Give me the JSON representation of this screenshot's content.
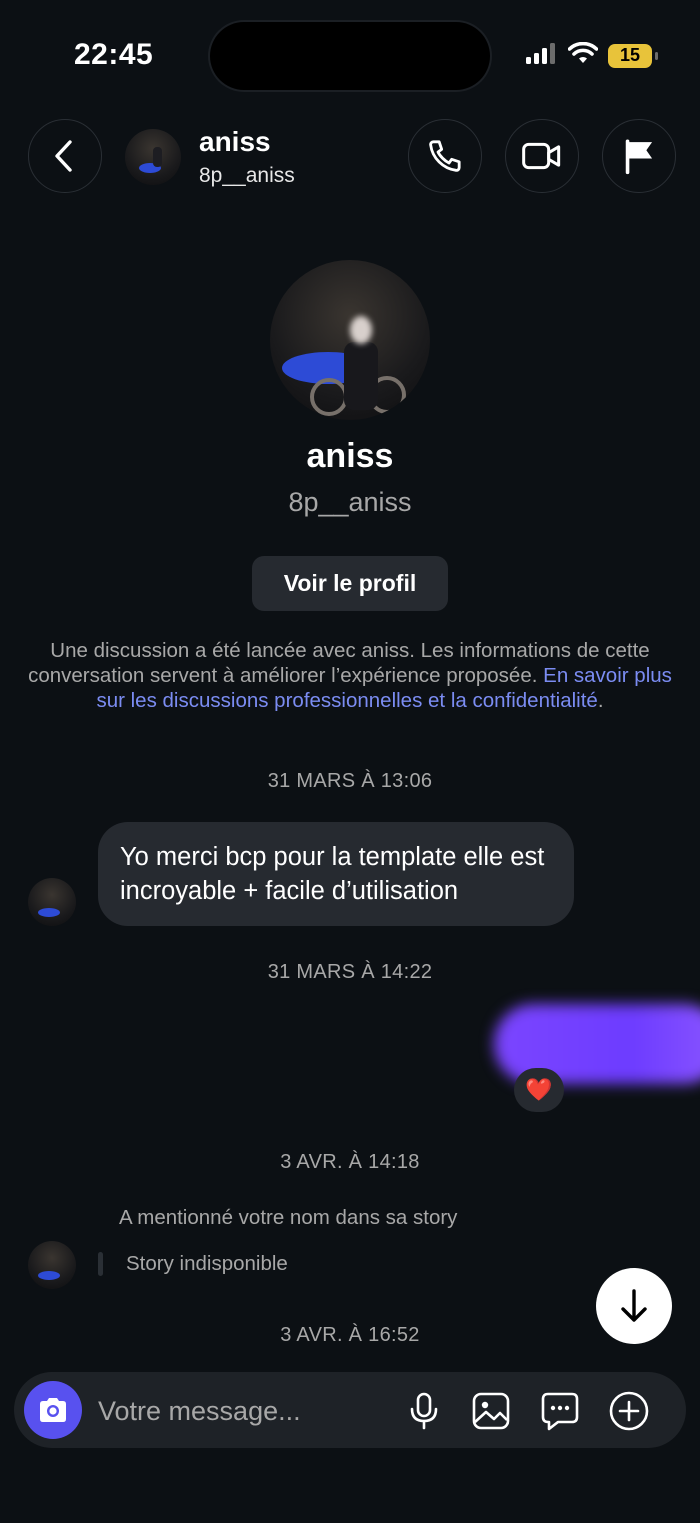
{
  "status_bar": {
    "time": "22:45",
    "battery": "15"
  },
  "header": {
    "name": "aniss",
    "username": "8p__aniss"
  },
  "profile": {
    "name": "aniss",
    "username": "8p__aniss",
    "view_profile_label": "Voir le profil"
  },
  "info": {
    "text": "Une discussion a été lancée avec aniss. Les informations de cette conversation servent à améliorer l’expérience proposée. ",
    "link": "En savoir plus sur les discussions professionnelles et la confidentialité",
    "end": "."
  },
  "messages": {
    "ts1": "31 MARS À 13:06",
    "msg1": "Yo merci bcp pour la template elle est incroyable + facile d’utilisation",
    "ts2": "31 MARS À 14:22",
    "reaction": "❤️",
    "ts3": "3 AVR. À 14:18",
    "mention": "A mentionné votre nom dans sa story",
    "story": "Story indisponible",
    "ts4": "3 AVR. À 16:52"
  },
  "composer": {
    "placeholder": "Votre message..."
  },
  "colors": {
    "background": "#0c1014",
    "bubble": "#262a30",
    "accent": "#5851ef",
    "link": "#7b8cf2"
  }
}
